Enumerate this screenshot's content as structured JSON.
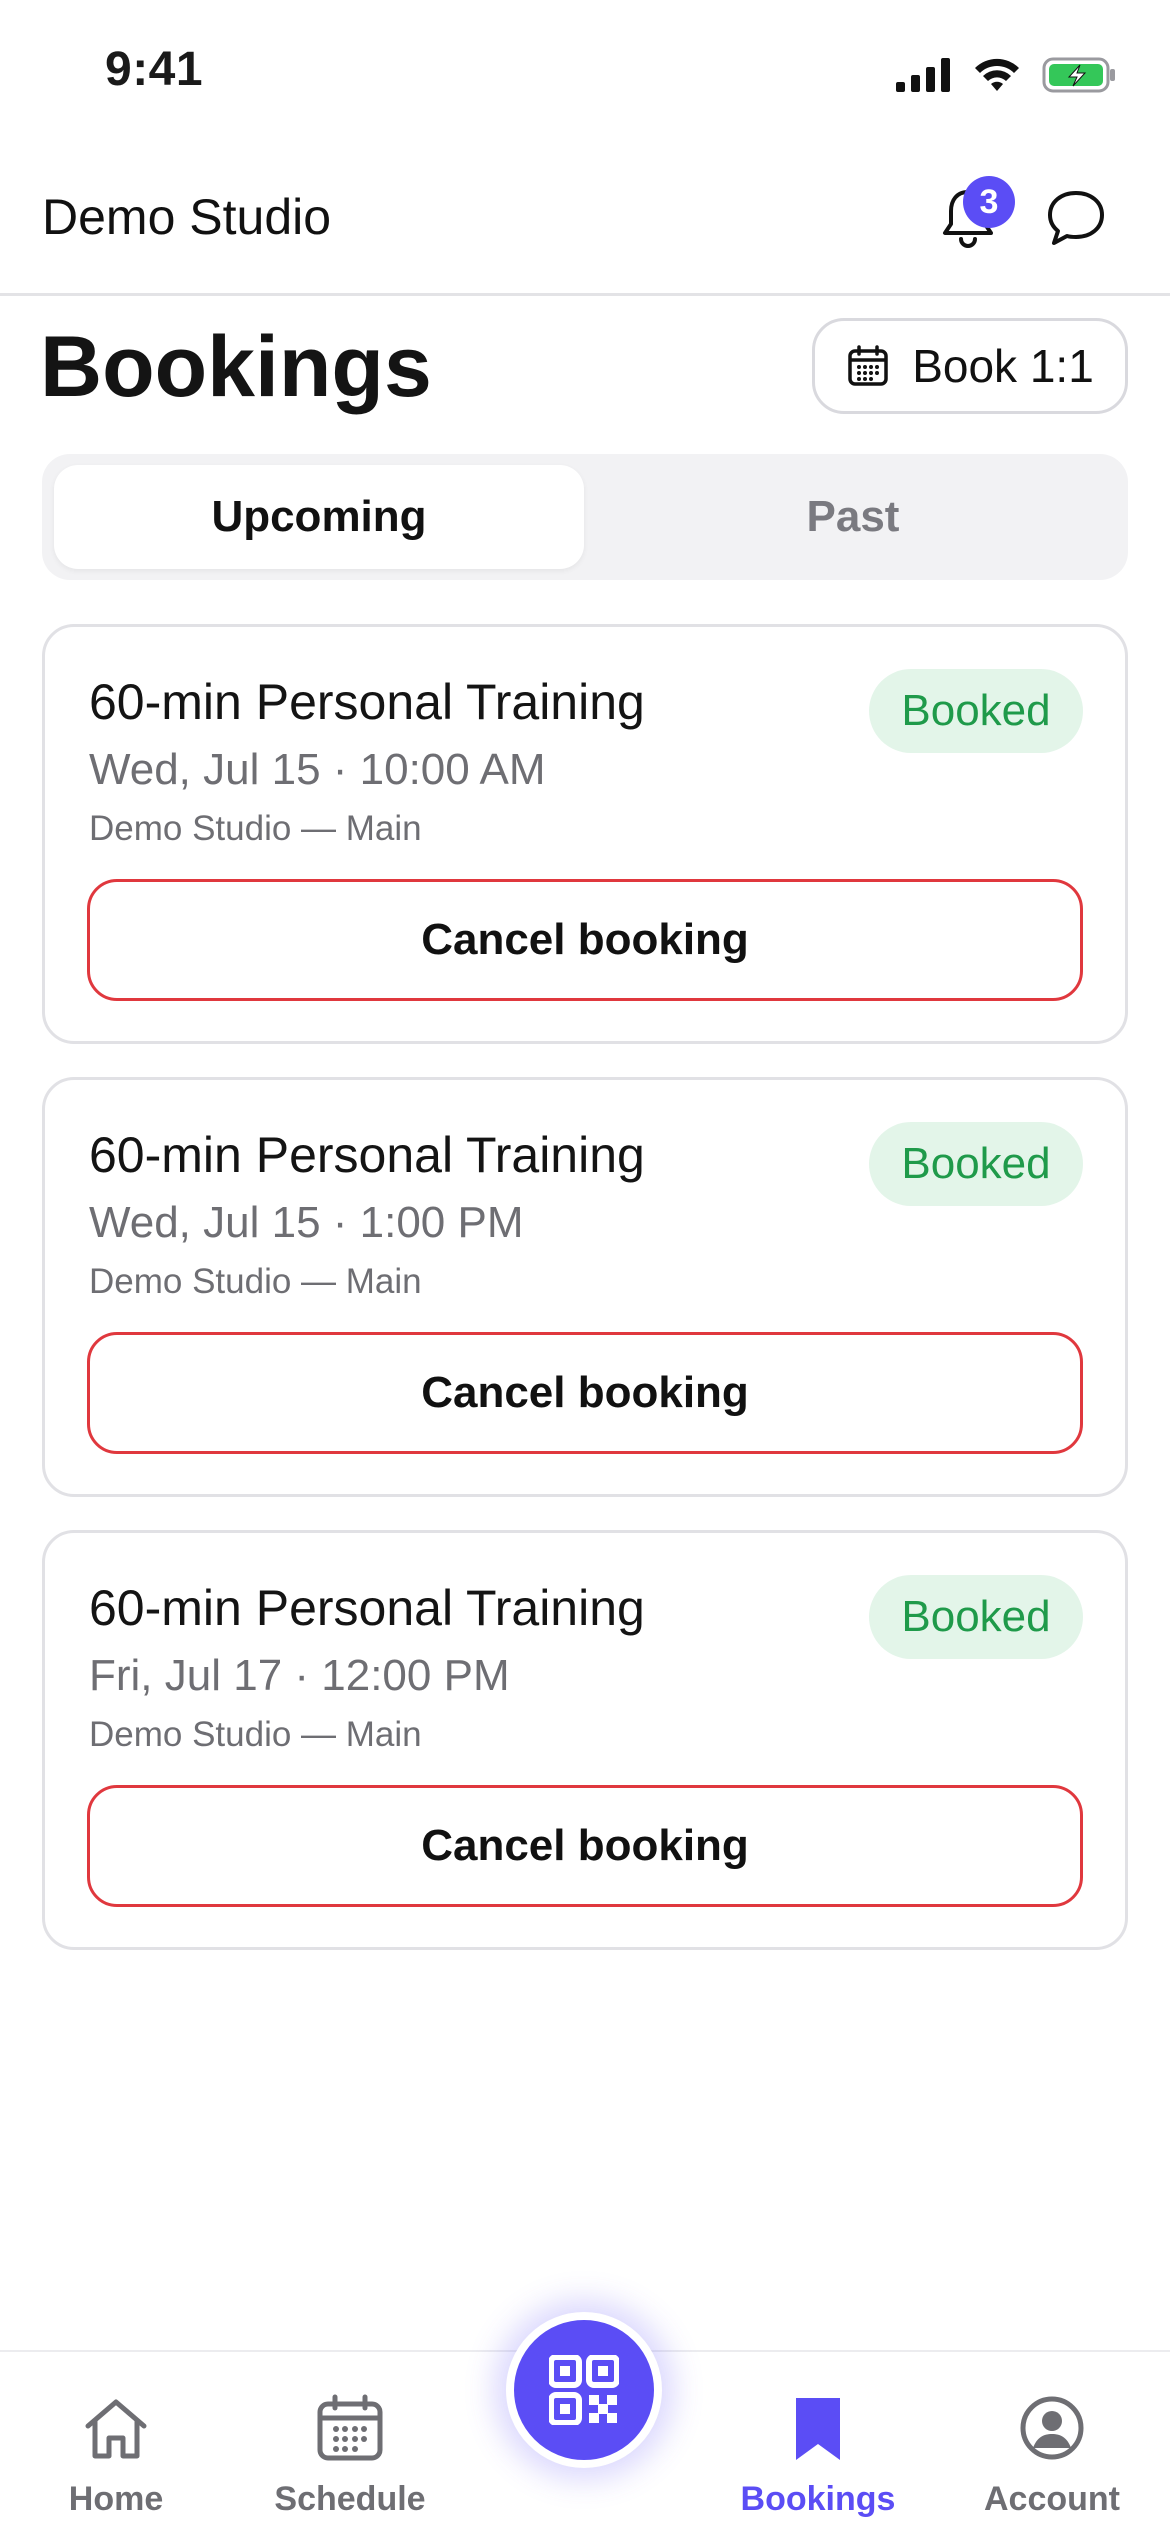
{
  "status_bar": {
    "time": "9:41"
  },
  "header": {
    "studio_name": "Demo Studio",
    "notification_count": "3"
  },
  "page": {
    "title": "Bookings",
    "book_button_label": "Book 1:1"
  },
  "tabs": {
    "upcoming": "Upcoming",
    "past": "Past",
    "selected": "Upcoming"
  },
  "bookings": [
    {
      "title": "60-min Personal Training",
      "datetime": "Wed, Jul 15 · 10:00 AM",
      "location": "Demo Studio — Main",
      "status": "Booked",
      "action": "Cancel booking"
    },
    {
      "title": "60-min Personal Training",
      "datetime": "Wed, Jul 15 · 1:00 PM",
      "location": "Demo Studio — Main",
      "status": "Booked",
      "action": "Cancel booking"
    },
    {
      "title": "60-min Personal Training",
      "datetime": "Fri, Jul 17 · 12:00 PM",
      "location": "Demo Studio — Main",
      "status": "Booked",
      "action": "Cancel booking"
    }
  ],
  "tab_bar": {
    "items": [
      {
        "label": "Home",
        "icon": "home-icon"
      },
      {
        "label": "Schedule",
        "icon": "calendar-icon"
      },
      {
        "label": "Bookings",
        "icon": "bookmark-icon",
        "active": true
      },
      {
        "label": "Account",
        "icon": "account-icon"
      }
    ],
    "center_action_icon": "qr-code-icon"
  },
  "colors": {
    "accent": "#5b4df5",
    "success": "#1f9a4a",
    "success_bg": "#e3f5e9",
    "danger": "#e0383e"
  }
}
